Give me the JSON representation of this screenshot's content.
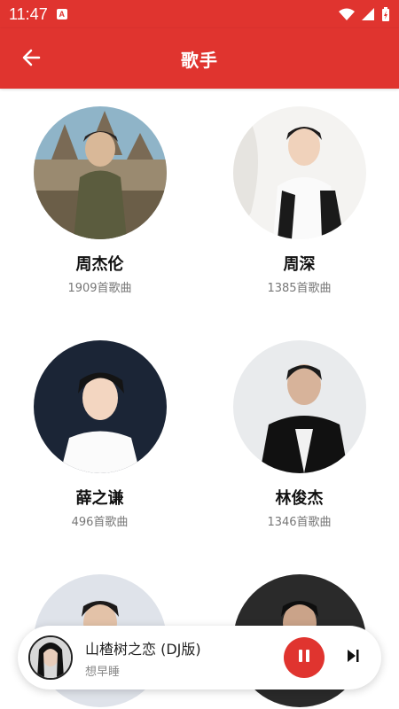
{
  "status_bar": {
    "time": "11:47",
    "notification_icon": "a-icon",
    "right_icons": [
      "wifi-icon",
      "signal-icon",
      "battery-charging-icon"
    ]
  },
  "app_bar": {
    "title": "歌手",
    "back_icon": "arrow-left-icon"
  },
  "artists": [
    {
      "name": "周杰伦",
      "count": "1909首歌曲"
    },
    {
      "name": "周深",
      "count": "1385首歌曲"
    },
    {
      "name": "薛之谦",
      "count": "496首歌曲"
    },
    {
      "name": "林俊杰",
      "count": "1346首歌曲"
    },
    {
      "name": "",
      "count": ""
    },
    {
      "name": "",
      "count": ""
    }
  ],
  "player": {
    "song_title": "山楂树之恋 (DJ版)",
    "song_artist": "想早睡",
    "state": "playing",
    "accent_color": "#e0342f"
  },
  "colors": {
    "primary": "#e0342f"
  }
}
